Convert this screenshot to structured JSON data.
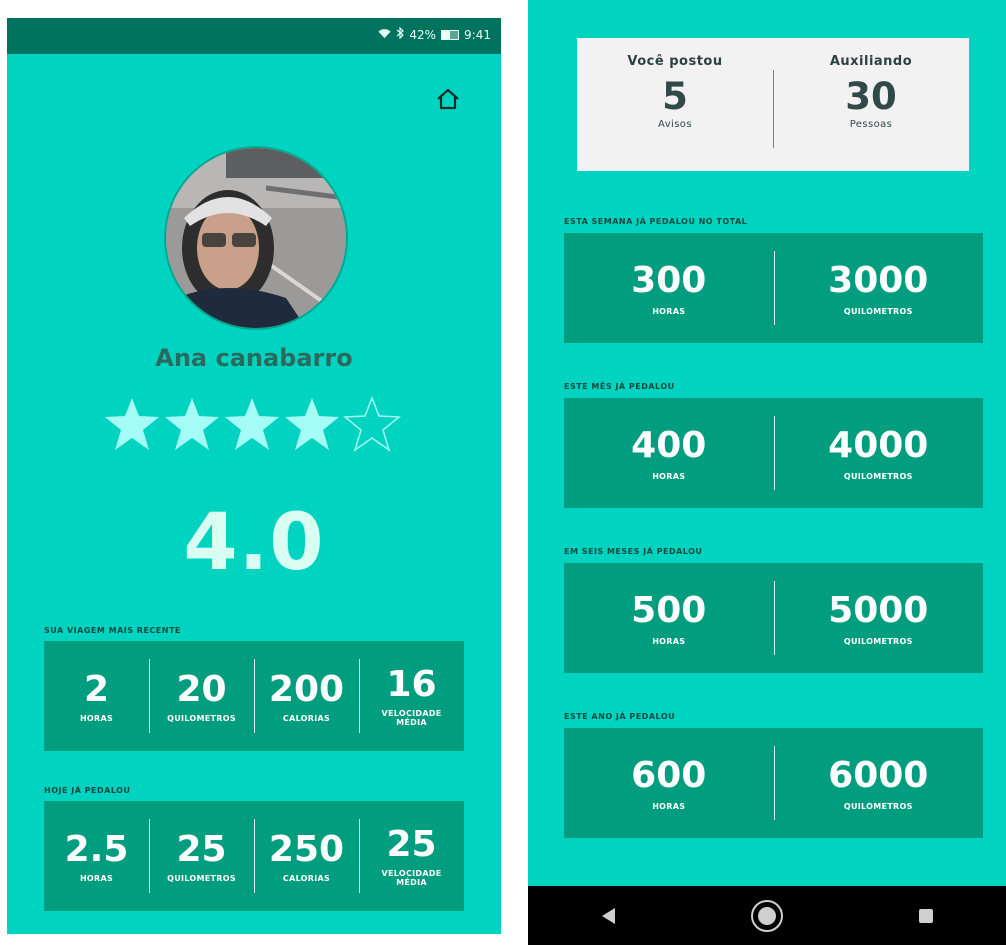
{
  "status_bar": {
    "battery": "42%",
    "time": "9:41"
  },
  "profile": {
    "name": "Ana canabarro",
    "rating": "4.0",
    "stars_filled": 4,
    "stars_total": 5
  },
  "recent_trip": {
    "label": "SUA VIAGEM MAIS RECENTE",
    "stats": [
      {
        "value": "2",
        "label": "HORAS"
      },
      {
        "value": "20",
        "label": "QUILOMETROS"
      },
      {
        "value": "200",
        "label": "CALORIAS"
      },
      {
        "value": "16",
        "label": "VELOCIDADE MÉDIA"
      }
    ]
  },
  "today": {
    "label": "HOJE JÁ PEDALOU",
    "stats": [
      {
        "value": "2.5",
        "label": "HORAS"
      },
      {
        "value": "25",
        "label": "QUILOMETROS"
      },
      {
        "value": "250",
        "label": "CALORIAS"
      },
      {
        "value": "25",
        "label": "VELOCIDADE MÉDIA"
      }
    ]
  },
  "posts": {
    "left": {
      "title": "Você postou",
      "value": "5",
      "unit": "Avisos"
    },
    "right": {
      "title": "Auxiliando",
      "value": "30",
      "unit": "Pessoas"
    }
  },
  "periods": [
    {
      "label": "ESTA SEMANA JÁ PEDALOU NO TOTAL",
      "hours": "300",
      "hours_label": "HORAS",
      "km": "3000",
      "km_label": "QUILOMETROS"
    },
    {
      "label": "ESTE MÊS JÁ PEDALOU",
      "hours": "400",
      "hours_label": "HORAS",
      "km": "4000",
      "km_label": "QUILOMETROS"
    },
    {
      "label": "EM SEIS MESES JÁ PEDALOU",
      "hours": "500",
      "hours_label": "HORAS",
      "km": "5000",
      "km_label": "QUILOMETROS"
    },
    {
      "label": "ESTE ANO JÁ PEDALOU",
      "hours": "600",
      "hours_label": "HORAS",
      "km": "6000",
      "km_label": "QUILOMETROS"
    }
  ],
  "colors": {
    "background": "#00d4c0",
    "status_bar": "#00735f",
    "card": "#009e7f",
    "star": "#a5fbf6"
  }
}
